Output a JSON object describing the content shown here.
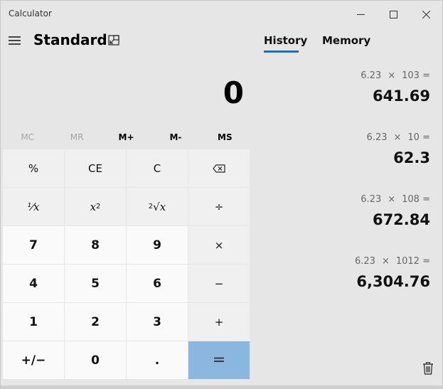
{
  "window": {
    "title": "Calculator"
  },
  "header": {
    "mode": "Standard"
  },
  "display": {
    "value": "0"
  },
  "memory_row": [
    "MC",
    "MR",
    "M+",
    "M-",
    "MS"
  ],
  "keypad": {
    "percent": "%",
    "ce": "CE",
    "c": "C",
    "reciprocal": "¹⁄x",
    "square": "x",
    "sqrt": "√x",
    "divide": "÷",
    "seven": "7",
    "eight": "8",
    "nine": "9",
    "multiply": "×",
    "four": "4",
    "five": "5",
    "six": "6",
    "minus": "−",
    "one": "1",
    "two": "2",
    "three": "3",
    "plus": "+",
    "negate": "+/−",
    "zero": "0",
    "decimal": ".",
    "equals": "="
  },
  "tabs": {
    "history": "History",
    "memory": "Memory"
  },
  "history": [
    {
      "a": "6.23",
      "op": "×",
      "b": "103",
      "eq": "=",
      "result": "641.69"
    },
    {
      "a": "6.23",
      "op": "×",
      "b": "10",
      "eq": "=",
      "result": "62.3"
    },
    {
      "a": "6.23",
      "op": "×",
      "b": "108",
      "eq": "=",
      "result": "672.84"
    },
    {
      "a": "6.23",
      "op": "×",
      "b": "1012",
      "eq": "=",
      "result": "6,304.76"
    }
  ]
}
